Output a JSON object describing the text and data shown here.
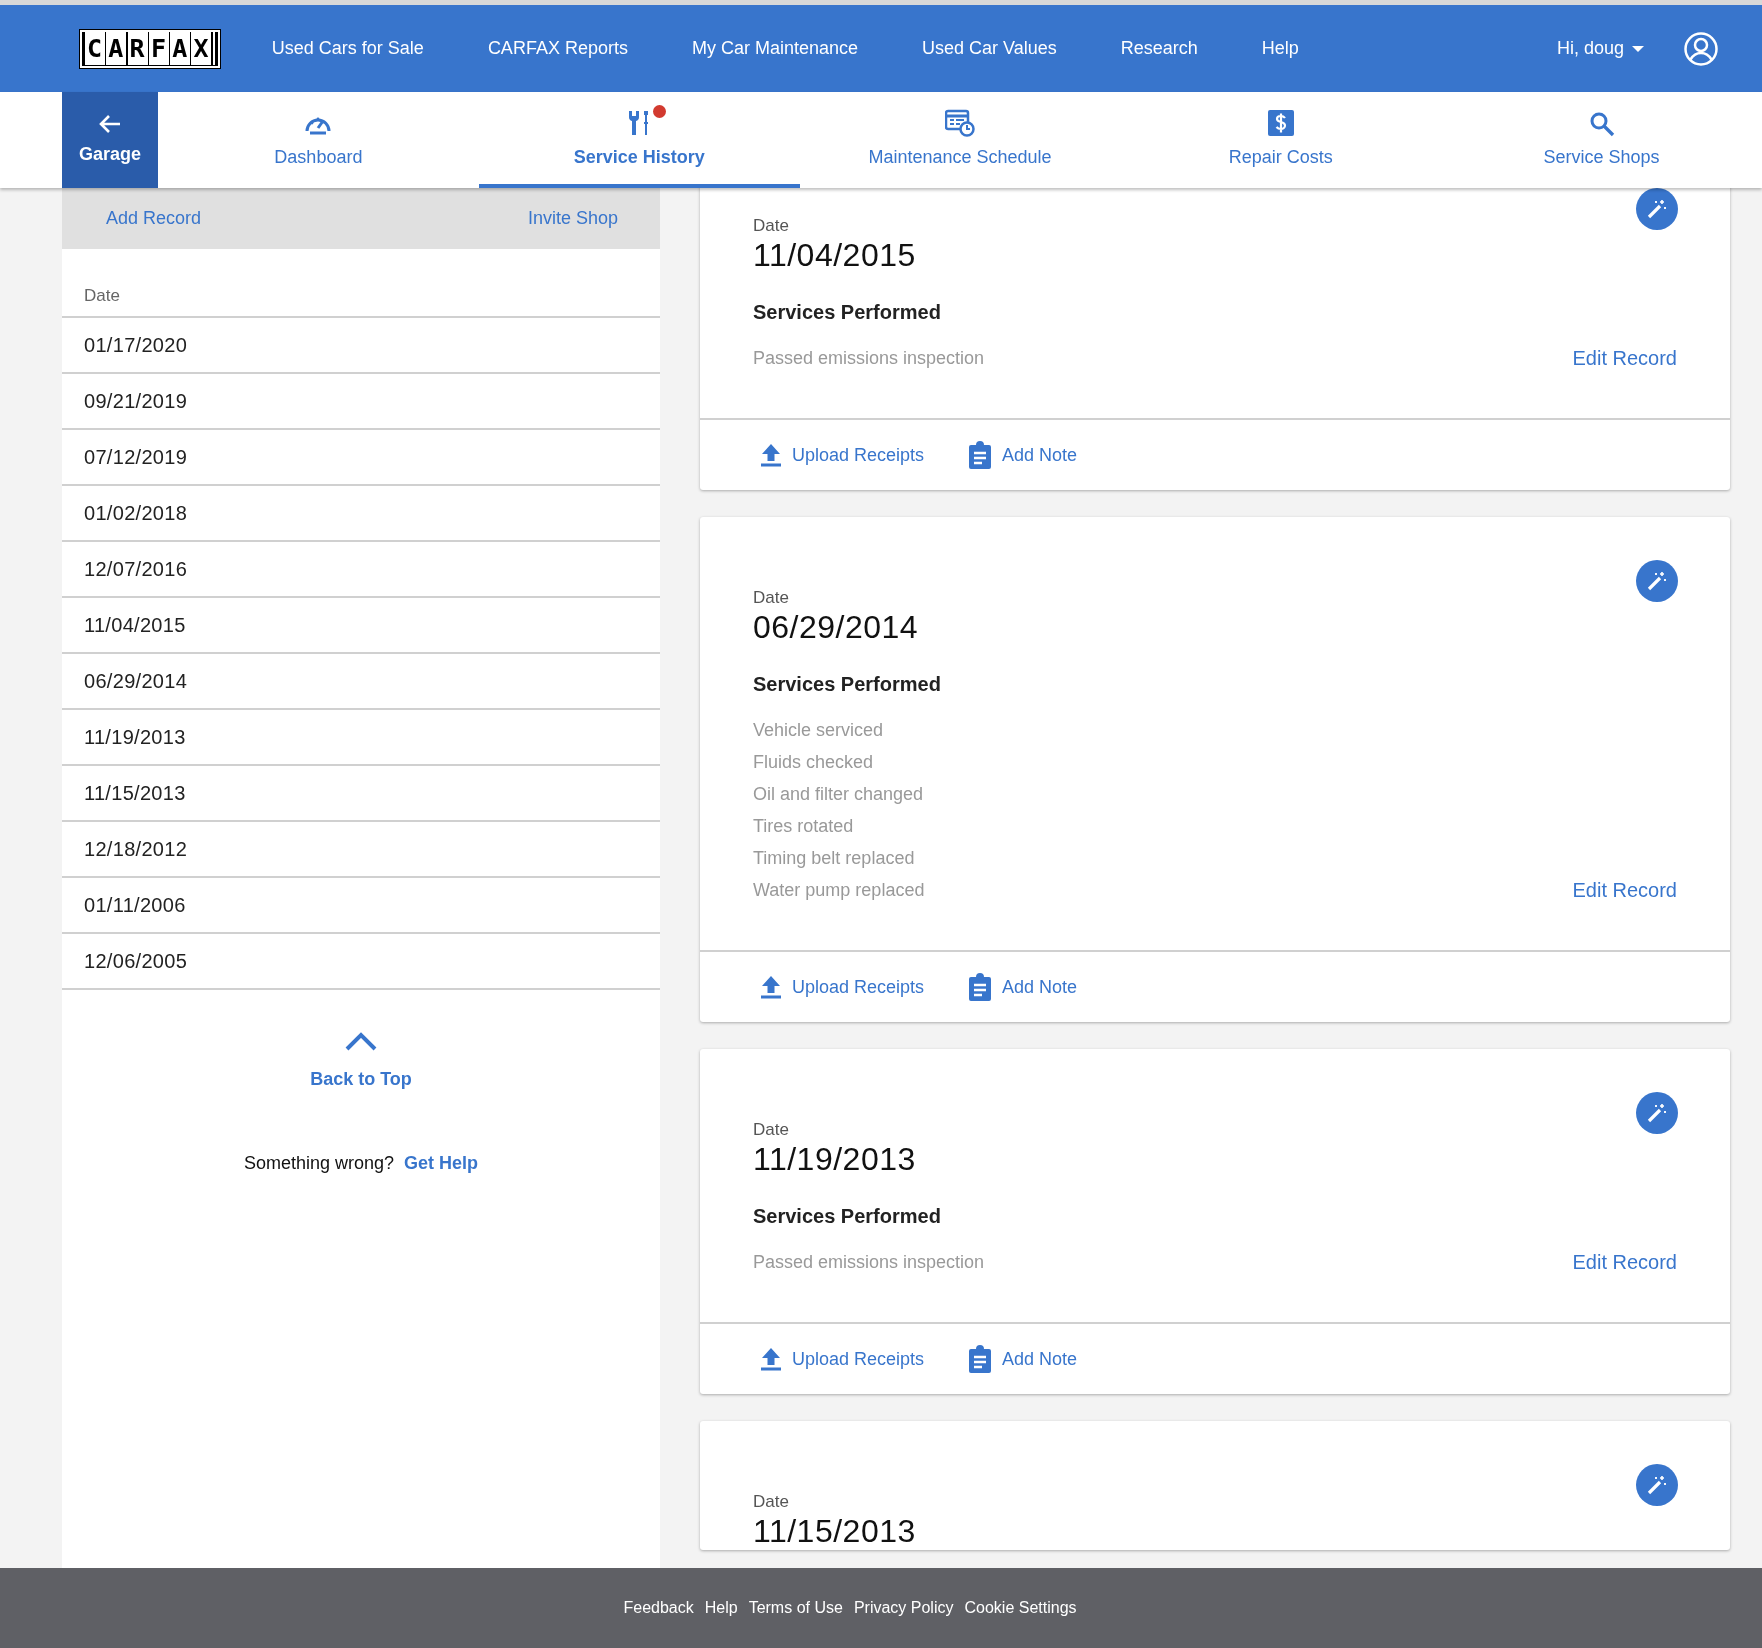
{
  "top_nav": {
    "logo": "CARFAX",
    "links": [
      {
        "label": "Used Cars for Sale"
      },
      {
        "label": "CARFAX Reports"
      },
      {
        "label": "My Car Maintenance"
      },
      {
        "label": "Used Car Values"
      },
      {
        "label": "Research"
      },
      {
        "label": "Help"
      }
    ],
    "user": {
      "greeting": "Hi, doug"
    }
  },
  "sub_nav": {
    "back": {
      "label": "Garage"
    },
    "tabs": [
      {
        "label": "Dashboard",
        "selected": false,
        "alert": false
      },
      {
        "label": "Service History",
        "selected": true,
        "alert": true
      },
      {
        "label": "Maintenance Schedule",
        "selected": false,
        "alert": false
      },
      {
        "label": "Repair Costs",
        "selected": false,
        "alert": false
      },
      {
        "label": "Service Shops",
        "selected": false,
        "alert": false
      }
    ]
  },
  "sidebar": {
    "actions": [
      "Add Record",
      "Invite Shop"
    ],
    "column": "Date",
    "dates": [
      "01/17/2020",
      "09/21/2019",
      "07/12/2019",
      "01/02/2018",
      "12/07/2016",
      "11/04/2015",
      "06/29/2014",
      "11/19/2013",
      "11/15/2013",
      "12/18/2012",
      "01/11/2006",
      "12/06/2005"
    ],
    "back_to_top": "Back to Top",
    "help": {
      "prompt": "Something wrong?",
      "link": "Get Help"
    }
  },
  "records": [
    {
      "date_label": "Date",
      "date": "11/04/2015",
      "heading": "Services Performed",
      "services": [
        "Passed emissions inspection"
      ],
      "edit": "Edit Record",
      "actions": [
        {
          "kind": "upload",
          "label": "Upload Receipts"
        },
        {
          "kind": "note",
          "label": "Add Note"
        }
      ]
    },
    {
      "date_label": "Date",
      "date": "06/29/2014",
      "heading": "Services Performed",
      "services": [
        "Vehicle serviced",
        "Fluids checked",
        "Oil and filter changed",
        "Tires rotated",
        "Timing belt replaced",
        "Water pump replaced"
      ],
      "edit": "Edit Record",
      "actions": [
        {
          "kind": "upload",
          "label": "Upload Receipts"
        },
        {
          "kind": "note",
          "label": "Add Note"
        }
      ]
    },
    {
      "date_label": "Date",
      "date": "11/19/2013",
      "heading": "Services Performed",
      "services": [
        "Passed emissions inspection"
      ],
      "edit": "Edit Record",
      "actions": [
        {
          "kind": "upload",
          "label": "Upload Receipts"
        },
        {
          "kind": "note",
          "label": "Add Note"
        }
      ]
    },
    {
      "date_label": "Date",
      "date": "11/15/2013"
    }
  ],
  "footer": {
    "links": [
      "Feedback",
      "Help",
      "Terms of Use",
      "Privacy Policy",
      "Cookie Settings"
    ]
  }
}
